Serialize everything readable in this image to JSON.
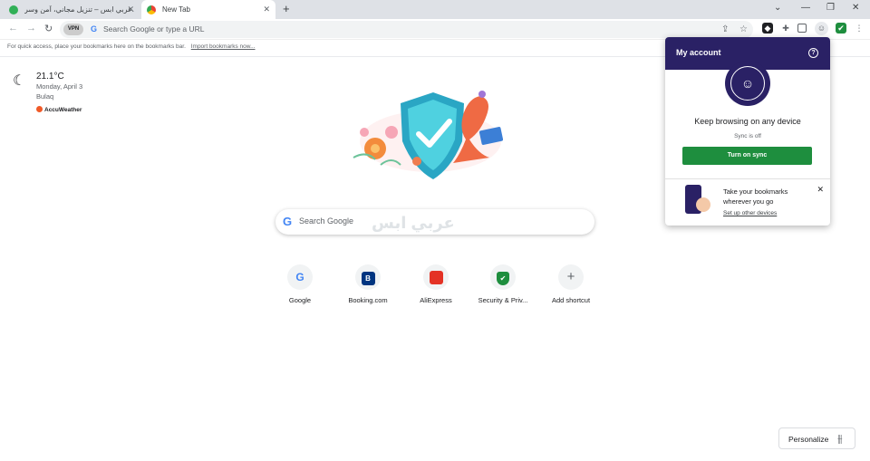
{
  "tabs": [
    {
      "title": "عربي ابس – تنزيل مجاني، آمن وسر...",
      "favicon": "arabic-apps-logo-icon",
      "color": "#31b057"
    },
    {
      "title": "New Tab",
      "favicon": "chrome-icon",
      "color": "#4285f4"
    }
  ],
  "window_controls": {
    "new_tab": "+",
    "tab_search": "⌄",
    "minimize": "—",
    "restore": "❐",
    "close": "✕"
  },
  "omnibox": {
    "vpn": "VPN",
    "placeholder": "Search Google or type a URL"
  },
  "bookmarks_bar": {
    "text": "For quick access, place your bookmarks here on the bookmarks bar.",
    "link": "Import bookmarks now..."
  },
  "weather": {
    "temperature": "21.1°C",
    "date": "Monday, April 3",
    "location": "Bulaq",
    "provider": "AccuWeather"
  },
  "search": {
    "placeholder": "Search Google"
  },
  "watermark": "عربي ابس",
  "shortcuts": [
    {
      "label": "Google",
      "icon": "google-icon",
      "glyph": "G",
      "color": "#4285f4"
    },
    {
      "label": "Booking.com",
      "icon": "booking-icon",
      "glyph": "B",
      "color": "#003580"
    },
    {
      "label": "AliExpress",
      "icon": "aliexpress-icon",
      "glyph": "🛍",
      "color": "#e43225"
    },
    {
      "label": "Security & Priv...",
      "icon": "shield-check-icon",
      "glyph": "✔",
      "color": "#1e8e3e"
    },
    {
      "label": "Add shortcut",
      "icon": "plus-icon",
      "glyph": "+",
      "color": "#5f6368"
    }
  ],
  "account_popup": {
    "title": "My account",
    "heading": "Keep browsing on any device",
    "sync_status": "Sync is off",
    "sync_button": "Turn on sync",
    "promo_text": "Take your bookmarks wherever you go",
    "promo_link": "Set up other devices",
    "accent_color": "#2a2165",
    "button_color": "#1e8e3e"
  },
  "personalize": {
    "label": "Personalize"
  }
}
